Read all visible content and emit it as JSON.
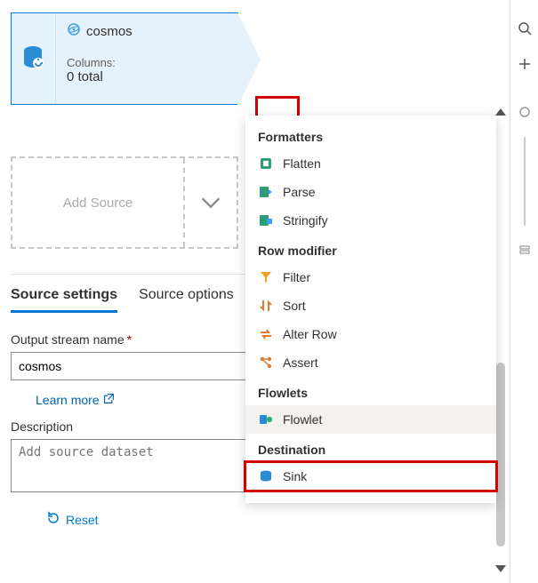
{
  "node": {
    "title": "cosmos",
    "columns_label": "Columns:",
    "columns_value": "0 total"
  },
  "add_source_label": "Add Source",
  "tabs": {
    "settings": "Source settings",
    "options": "Source options"
  },
  "form": {
    "output_label": "Output stream name",
    "output_value": "cosmos",
    "learn_more": "Learn more",
    "description_label": "Description",
    "description_placeholder": "Add source dataset",
    "reset": "Reset"
  },
  "menu": {
    "sections": {
      "formatters": {
        "header": "Formatters",
        "items": {
          "flatten": "Flatten",
          "parse": "Parse",
          "stringify": "Stringify"
        }
      },
      "row_modifier": {
        "header": "Row modifier",
        "items": {
          "filter": "Filter",
          "sort": "Sort",
          "alter_row": "Alter Row",
          "assert": "Assert"
        }
      },
      "flowlets": {
        "header": "Flowlets",
        "items": {
          "flowlet": "Flowlet"
        }
      },
      "destination": {
        "header": "Destination",
        "items": {
          "sink": "Sink"
        }
      }
    }
  }
}
